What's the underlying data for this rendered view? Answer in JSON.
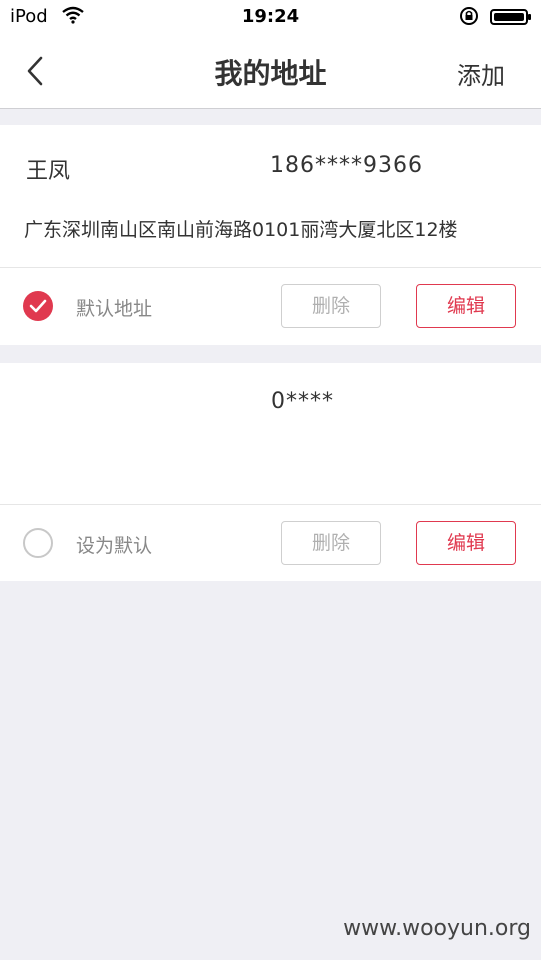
{
  "status_bar": {
    "carrier": "iPod",
    "time": "19:24"
  },
  "navbar": {
    "title": "我的地址",
    "add_label": "添加"
  },
  "addresses": [
    {
      "name": "王凤",
      "phone": "186****9366",
      "address": "广东深圳南山区南山前海路0101丽湾大厦北区12楼",
      "is_default": true,
      "default_label": "默认地址",
      "delete_label": "删除",
      "edit_label": "编辑"
    },
    {
      "name": "",
      "phone": "0****",
      "address": "",
      "is_default": false,
      "default_label": "设为默认",
      "delete_label": "删除",
      "edit_label": "编辑"
    }
  ],
  "colors": {
    "accent": "#e0394f",
    "background": "#efeff4"
  },
  "watermark": "www.wooyun.org"
}
